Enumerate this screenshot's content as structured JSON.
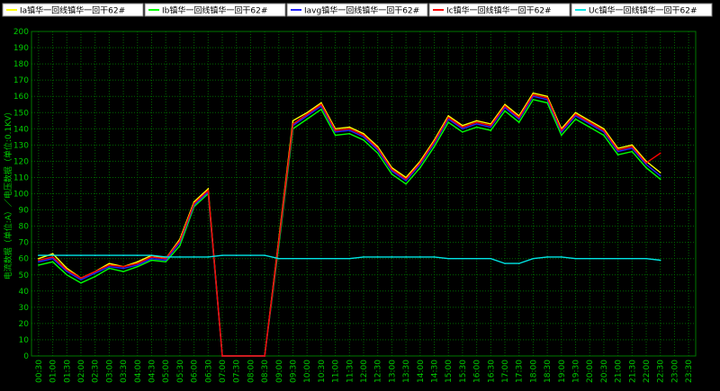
{
  "chart_data": {
    "type": "line",
    "ylabel": "电流数据（单位:A）／电压数据（单位:0.1KV）",
    "ylim": [
      0,
      200
    ],
    "y_ticks": [
      0,
      10,
      20,
      30,
      40,
      50,
      60,
      70,
      80,
      90,
      100,
      110,
      120,
      130,
      140,
      150,
      160,
      170,
      180,
      190,
      200
    ],
    "grid": true,
    "legend_position": "top",
    "x": [
      "00:30",
      "01:00",
      "01:30",
      "02:00",
      "02:30",
      "03:00",
      "03:30",
      "04:00",
      "04:30",
      "05:00",
      "05:30",
      "06:00",
      "06:30",
      "07:00",
      "07:30",
      "08:00",
      "08:30",
      "09:00",
      "09:30",
      "10:00",
      "10:30",
      "11:00",
      "11:30",
      "12:00",
      "12:30",
      "13:00",
      "13:30",
      "14:00",
      "14:30",
      "15:00",
      "15:30",
      "16:00",
      "16:30",
      "17:00",
      "17:30",
      "18:00",
      "18:30",
      "19:00",
      "19:30",
      "20:00",
      "20:30",
      "21:00",
      "21:30",
      "22:00",
      "22:30",
      "23:00",
      "23:30"
    ],
    "series": [
      {
        "name": "Ia镇华一回线镇华一回干62#",
        "color": "#ffff00",
        "values": [
          60,
          63,
          54,
          48,
          52,
          57,
          55,
          58,
          62,
          60,
          72,
          95,
          103,
          0,
          0,
          0,
          0,
          72,
          145,
          150,
          156,
          140,
          141,
          137,
          129,
          116,
          110,
          120,
          133,
          148,
          142,
          145,
          143,
          155,
          148,
          162,
          160,
          140,
          150,
          145,
          140,
          128,
          130,
          120,
          113,
          null,
          null
        ]
      },
      {
        "name": "Ib镇华一回线镇华一回干62#",
        "color": "#00ff00",
        "values": [
          56,
          58,
          50,
          45,
          49,
          54,
          52,
          55,
          59,
          58,
          68,
          92,
          100,
          0,
          0,
          0,
          0,
          68,
          140,
          146,
          152,
          136,
          137,
          133,
          125,
          112,
          106,
          116,
          129,
          144,
          138,
          141,
          139,
          151,
          144,
          158,
          156,
          136,
          146,
          141,
          136,
          124,
          126,
          116,
          109,
          null,
          null
        ]
      },
      {
        "name": "Iavg镇华一回线镇华一回干62#",
        "color": "#2222ff",
        "values": [
          58,
          60,
          52,
          47,
          51,
          55,
          54,
          56,
          60,
          59,
          70,
          93,
          101,
          0,
          0,
          0,
          0,
          70,
          142,
          148,
          154,
          138,
          139,
          135,
          127,
          114,
          108,
          118,
          131,
          146,
          140,
          143,
          141,
          153,
          146,
          160,
          158,
          138,
          148,
          143,
          138,
          126,
          128,
          118,
          111,
          null,
          null
        ]
      },
      {
        "name": "Ic镇华一回线镇华一回干62#",
        "color": "#ff0000",
        "values": [
          59,
          61,
          53,
          48,
          52,
          56,
          55,
          57,
          61,
          60,
          71,
          94,
          102,
          0,
          0,
          0,
          0,
          71,
          143,
          149,
          155,
          139,
          140,
          136,
          128,
          115,
          109,
          119,
          132,
          147,
          141,
          144,
          142,
          154,
          147,
          161,
          159,
          139,
          149,
          144,
          139,
          127,
          129,
          119,
          125,
          null,
          null
        ]
      },
      {
        "name": "Uc镇华一回线镇华一回干62#",
        "color": "#00e5e5",
        "values": [
          62,
          62,
          62,
          62,
          62,
          62,
          62,
          62,
          62,
          61,
          61,
          61,
          61,
          62,
          62,
          62,
          62,
          60,
          60,
          60,
          60,
          60,
          60,
          61,
          61,
          61,
          61,
          61,
          61,
          60,
          60,
          60,
          60,
          57,
          57,
          60,
          61,
          61,
          60,
          60,
          60,
          60,
          60,
          60,
          59,
          null,
          null
        ]
      }
    ]
  }
}
